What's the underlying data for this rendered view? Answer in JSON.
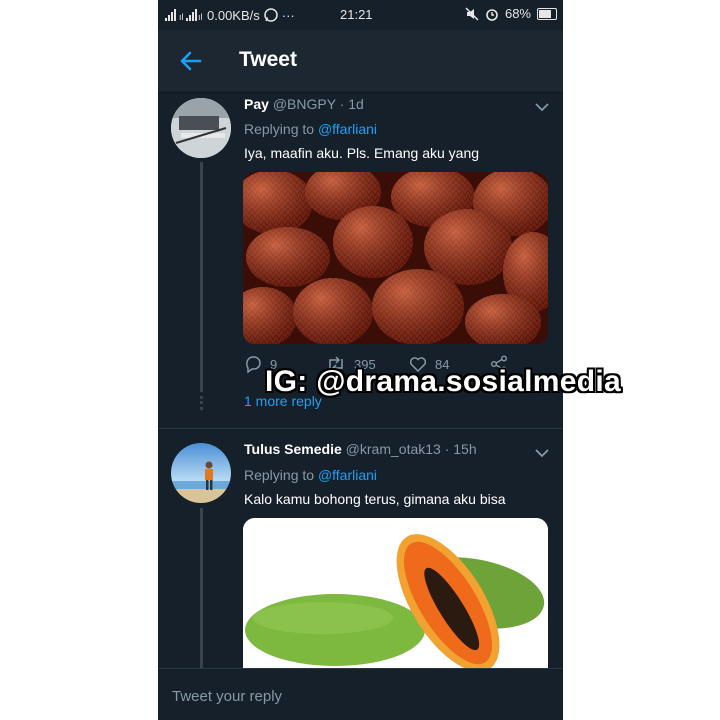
{
  "status_bar": {
    "network": ".ılı ²ᴳ.ıl ",
    "speed": "0.00KB/s",
    "more": "···",
    "time": "21:21",
    "battery": "68%"
  },
  "header": {
    "title": "Tweet"
  },
  "tweets": [
    {
      "name": "Pay",
      "handle": "@BNGPY",
      "time": "· 1d",
      "replying_label": "Replying to",
      "replying_handle": "@ffarliani",
      "text": "Iya, maafin aku. Pls. Emang aku yang",
      "media": "salak-fruit-photo",
      "replies": "9",
      "retweets": "395",
      "likes": "84",
      "more_replies": "1 more reply"
    },
    {
      "name": "Tulus Semedie",
      "handle": "@kram_otak13",
      "time": "· 15h",
      "replying_label": "Replying to",
      "replying_handle": "@ffarliani",
      "text": "Kalo kamu bohong terus, gimana aku bisa",
      "media": "papaya-photo"
    }
  ],
  "reply_box": {
    "placeholder": "Tweet your reply"
  },
  "watermark": "IG: @drama.sosialmedia",
  "colors": {
    "background": "#15202b",
    "header": "#1c2732",
    "accent": "#1da1f2",
    "secondary_text": "#8899a6"
  }
}
